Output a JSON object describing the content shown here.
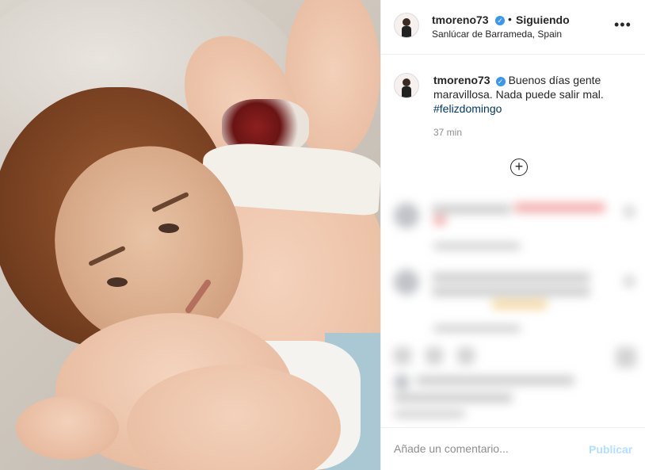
{
  "post": {
    "username": "tmoreno73",
    "follow_status": "Siguiendo",
    "separator": "•",
    "location": "Sanlúcar de Barrameda, Spain",
    "more_label": "•••",
    "verified_glyph": "✓",
    "caption_text": "Buenos días gente maravillosa. Nada puede salir mal.",
    "hashtag": "#felizdomingo",
    "time": "37 min",
    "load_more_icon": "plus-circle-icon",
    "load_more_glyph": "+"
  },
  "comment_box": {
    "placeholder": "Añade un comentario...",
    "publish_label": "Publicar"
  },
  "colors": {
    "verified": "#3897f0",
    "hashtag": "#00376b",
    "publish_disabled": "#b2dffc",
    "secondary_text": "#8e8e8e"
  }
}
